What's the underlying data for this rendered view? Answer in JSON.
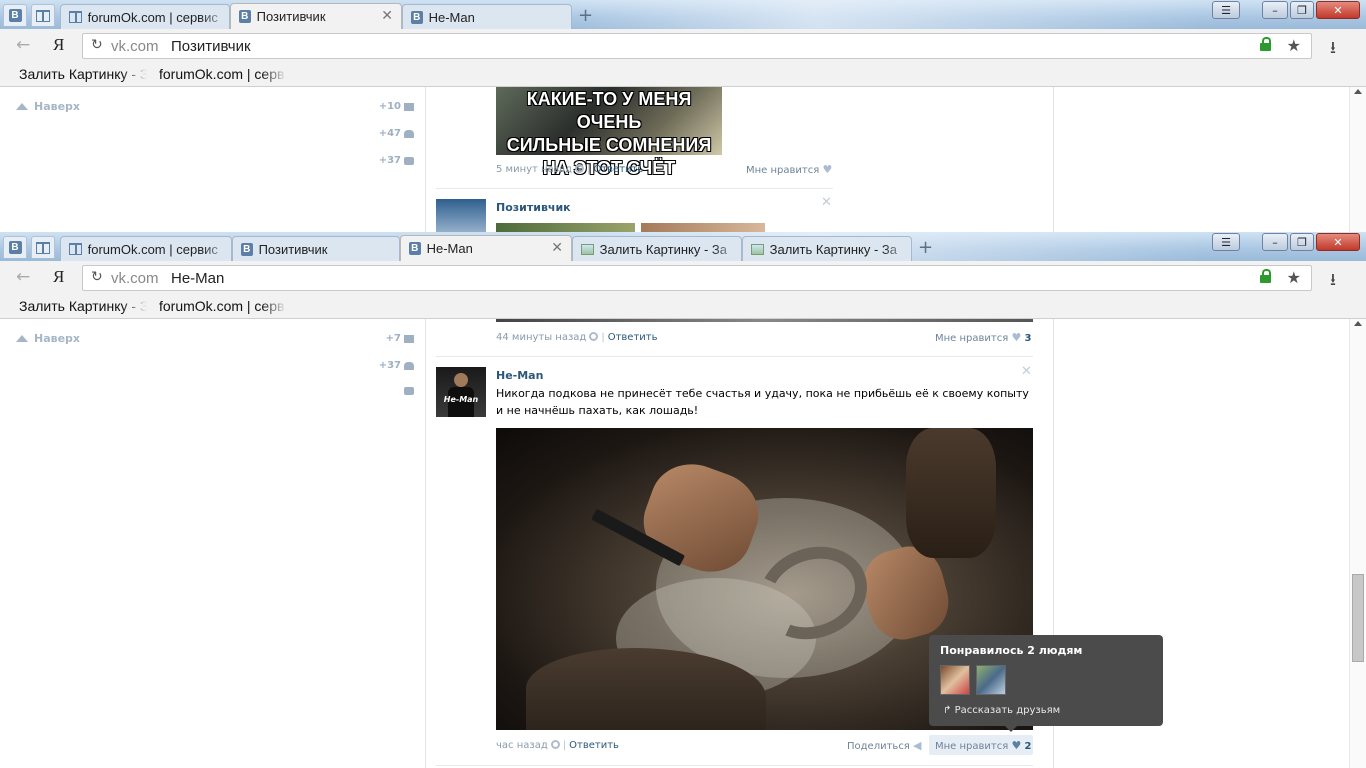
{
  "top_window": {
    "tabs": [
      {
        "label": "forumOk.com | сервис"
      },
      {
        "label": "Позитивчик"
      },
      {
        "label": "He-Man"
      }
    ],
    "address": {
      "domain": "vk.com",
      "title": "Позитивчик"
    },
    "bookmarks": [
      "Залить Картинку - З",
      "forumOk.com | серв"
    ],
    "left": {
      "naverh": "Наверх",
      "counters": [
        "+10",
        "+47",
        "+37"
      ]
    },
    "meme_text": [
      "КАКИЕ-ТО У МЕНЯ ОЧЕНЬ",
      "СИЛЬНЫЕ СОМНЕНИЯ",
      "НА ЭТОТ СЧЁТ"
    ],
    "post_meta": {
      "time": "5 минут назад",
      "reply": "Ответить",
      "like": "Мне нравится"
    },
    "next_author": "Позитивчик"
  },
  "bottom_window": {
    "tabs": [
      {
        "label": "forumOk.com | сервис"
      },
      {
        "label": "Позитивчик"
      },
      {
        "label": "He-Man"
      },
      {
        "label": "Залить Картинку - За"
      },
      {
        "label": "Залить Картинку - За"
      }
    ],
    "address": {
      "domain": "vk.com",
      "title": "He-Man"
    },
    "bookmarks": [
      "Залить Картинку - З",
      "forumOk.com | серв"
    ],
    "left": {
      "naverh": "Наверх",
      "counters": [
        "+7",
        "+37"
      ]
    },
    "prev_meta": {
      "time": "44 минуты назад",
      "reply": "Ответить",
      "like": "Мне нравится",
      "like_count": "3"
    },
    "post": {
      "author": "He-Man",
      "avatar_text": "He-Man",
      "text": "Никогда подкова не принесёт тебе счастья и удачу, пока не прибьёшь её к своему копыту и не начнёшь пахать, как лошадь!",
      "time": "час назад",
      "reply": "Ответить",
      "share": "Поделиться",
      "like": "Мне нравится",
      "like_count": "2"
    },
    "tooltip": {
      "title": "Понравилось 2 людям",
      "share": "Рассказать друзьям"
    }
  },
  "window_buttons": {
    "menu": "☰",
    "minimize": "–",
    "maximize": "❐",
    "close": "✕"
  },
  "nav": {
    "back": "←",
    "yandex": "Я",
    "reload": "↻",
    "star": "★",
    "download": "⭳",
    "newtab": "+"
  },
  "colors": {
    "vk_blue": "#5b7fa6",
    "link": "#2b587a",
    "tooltip_bg": "#4b4b4b"
  }
}
